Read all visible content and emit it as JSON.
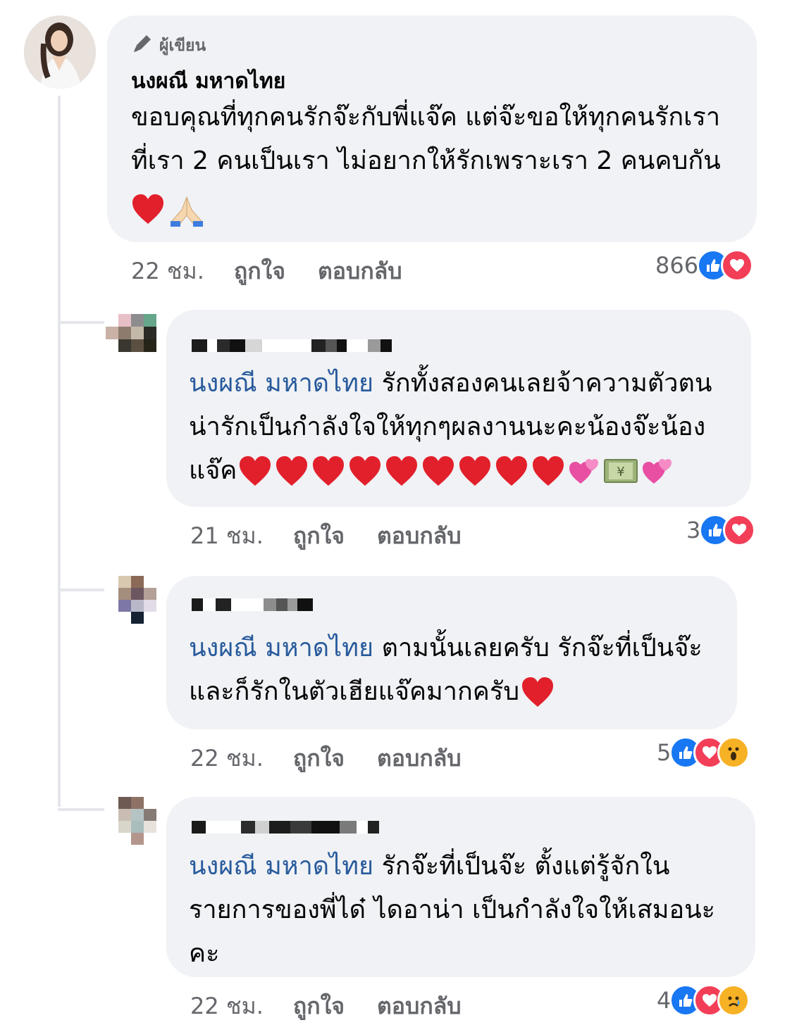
{
  "comments": [
    {
      "author_badge": "ผู้เขียน",
      "author_name": "นงผณี มหาดไทย",
      "lines": [
        "ขอบคุณที่ทุกคนรักจ๊ะกับพี่แจ๊ค แต่จ๊ะขอให้ทุกคนรักเรา",
        "ที่เรา 2 คนเป็นเรา ไม่อยากให้รักเพราะเรา 2 คนคบกัน"
      ],
      "emojis": [
        "heart",
        "folded-hands"
      ],
      "time": "22 ชม.",
      "like_label": "ถูกใจ",
      "reply_label": "ตอบกลับ",
      "reaction_count": "866",
      "reactions": [
        "like",
        "love"
      ]
    },
    {
      "mention": "นงผณี มหาดไทย",
      "lines": [
        "รักทั้งสองคนเลยจ้าความตัวตน",
        "น่ารักเป็นกำลังใจให้ทุกๆผลงานนะคะน้องจ๊ะน้อง",
        "แจ๊ค"
      ],
      "emojis": [
        "heart",
        "heart",
        "heart",
        "heart",
        "heart",
        "heart",
        "heart",
        "heart",
        "heart",
        "two-hearts",
        "money",
        "two-hearts"
      ],
      "time": "21 ชม.",
      "like_label": "ถูกใจ",
      "reply_label": "ตอบกลับ",
      "reaction_count": "3",
      "reactions": [
        "like",
        "love"
      ]
    },
    {
      "mention": "นงผณี มหาดไทย",
      "lines": [
        "ตามนั้นเลยครับ รักจ๊ะที่เป็นจ๊ะ",
        "และก็รักในตัวเฮียแจ๊คมากครับ"
      ],
      "emojis": [
        "heart"
      ],
      "time": "22 ชม.",
      "like_label": "ถูกใจ",
      "reply_label": "ตอบกลับ",
      "reaction_count": "5",
      "reactions": [
        "like",
        "love",
        "wow"
      ]
    },
    {
      "mention": "นงผณี มหาดไทย",
      "lines": [
        "รักจ๊ะที่เป็นจ๊ะ ตั้งแต่รู้จักใน",
        "รายการของพี่ได๋ ไดอาน่า เป็นกำลังใจให้เสมอนะ",
        "คะ"
      ],
      "time": "22 ชม.",
      "like_label": "ถูกใจ",
      "reply_label": "ตอบกลับ",
      "reaction_count": "4",
      "reactions": [
        "like",
        "love",
        "sad"
      ]
    }
  ],
  "colors": {
    "mention": "#285a9c",
    "bubble": "#f0f2f5",
    "meta": "#65676b",
    "like": "#1877f2",
    "love": "#f33e58",
    "emoji_yellow": "#f7b125"
  }
}
